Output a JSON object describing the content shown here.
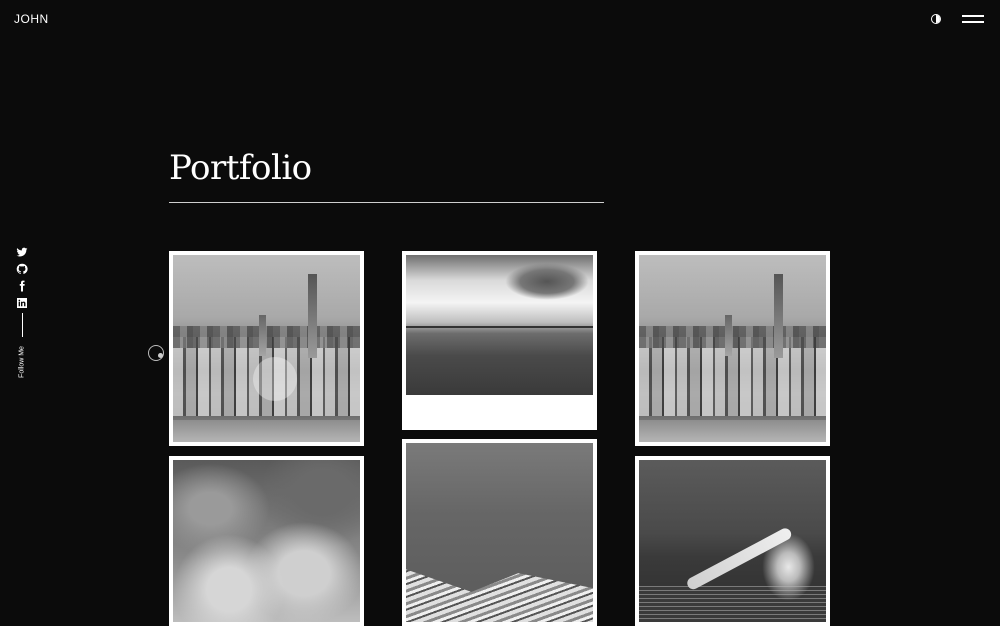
{
  "header": {
    "logo": "JOHN",
    "theme_toggle_icon": "contrast-icon",
    "menu_icon": "hamburger-menu-icon"
  },
  "social": {
    "icons": [
      "twitter-icon",
      "github-icon",
      "facebook-icon",
      "linkedin-icon"
    ],
    "follow_label": "Follow Me"
  },
  "main": {
    "title": "Portfolio"
  },
  "portfolio": {
    "items": [
      {
        "photo": "city-skyline-bw"
      },
      {
        "photo": "seascape-bw"
      },
      {
        "photo": "city-skyline-bw"
      },
      {
        "photo": "flowers-bw"
      },
      {
        "photo": "wing-bw"
      },
      {
        "photo": "swimmer-bw"
      }
    ]
  },
  "colors": {
    "background": "#0b0b0b",
    "text": "#ffffff",
    "card_border": "#ffffff"
  }
}
